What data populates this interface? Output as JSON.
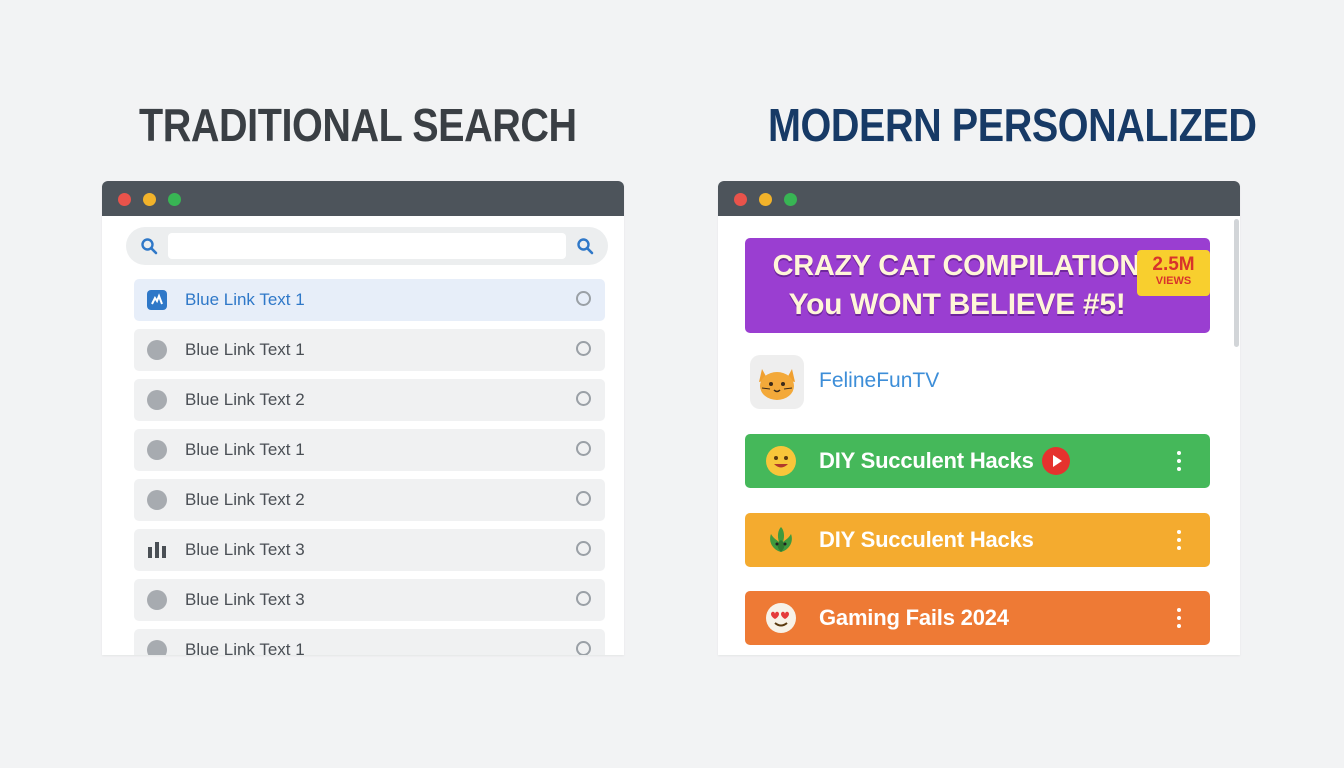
{
  "left": {
    "heading": "TRADITIONAL SEARCH",
    "search": {
      "value": ""
    },
    "results": [
      {
        "label": "Blue Link Text 1",
        "icon": "favicon-icon",
        "active": true
      },
      {
        "label": "Blue Link Text 1",
        "icon": "circle-icon"
      },
      {
        "label": "Blue Link Text 2",
        "icon": "circle-icon"
      },
      {
        "label": "Blue Link Text 1",
        "icon": "circle-icon"
      },
      {
        "label": "Blue Link Text 2",
        "icon": "circle-icon"
      },
      {
        "label": "Blue Link Text 3",
        "icon": "bar-chart-icon"
      },
      {
        "label": "Blue Link Text 3",
        "icon": "circle-icon"
      },
      {
        "label": "Blue Link Text 1",
        "icon": "circle-icon"
      }
    ]
  },
  "right": {
    "heading": "MODERN PERSONALIZED",
    "hero": {
      "line1": "CRAZY CAT COMPILATION!",
      "line2": "You WONT BELIEVE #5!",
      "views_count": "2.5M",
      "views_label": "VIEWS"
    },
    "channel": {
      "name": "FelineFunTV",
      "avatar_icon": "cat-face-icon"
    },
    "videos": [
      {
        "title": "DIY Succulent Hacks",
        "emoji": "smiley-face-icon",
        "color": "#45b85a",
        "play": true
      },
      {
        "title": "DIY Succulent Hacks",
        "emoji": "succulent-plant-icon",
        "color": "#f4ab2f"
      },
      {
        "title": "Gaming Fails 2024",
        "emoji": "heart-eyes-face-icon",
        "color": "#ee7a35"
      }
    ]
  },
  "colors": {
    "background": "#f2f3f4",
    "titlebar": "#4d545b",
    "hero": "#9a3ed1",
    "link_active": "#2f78c8"
  }
}
